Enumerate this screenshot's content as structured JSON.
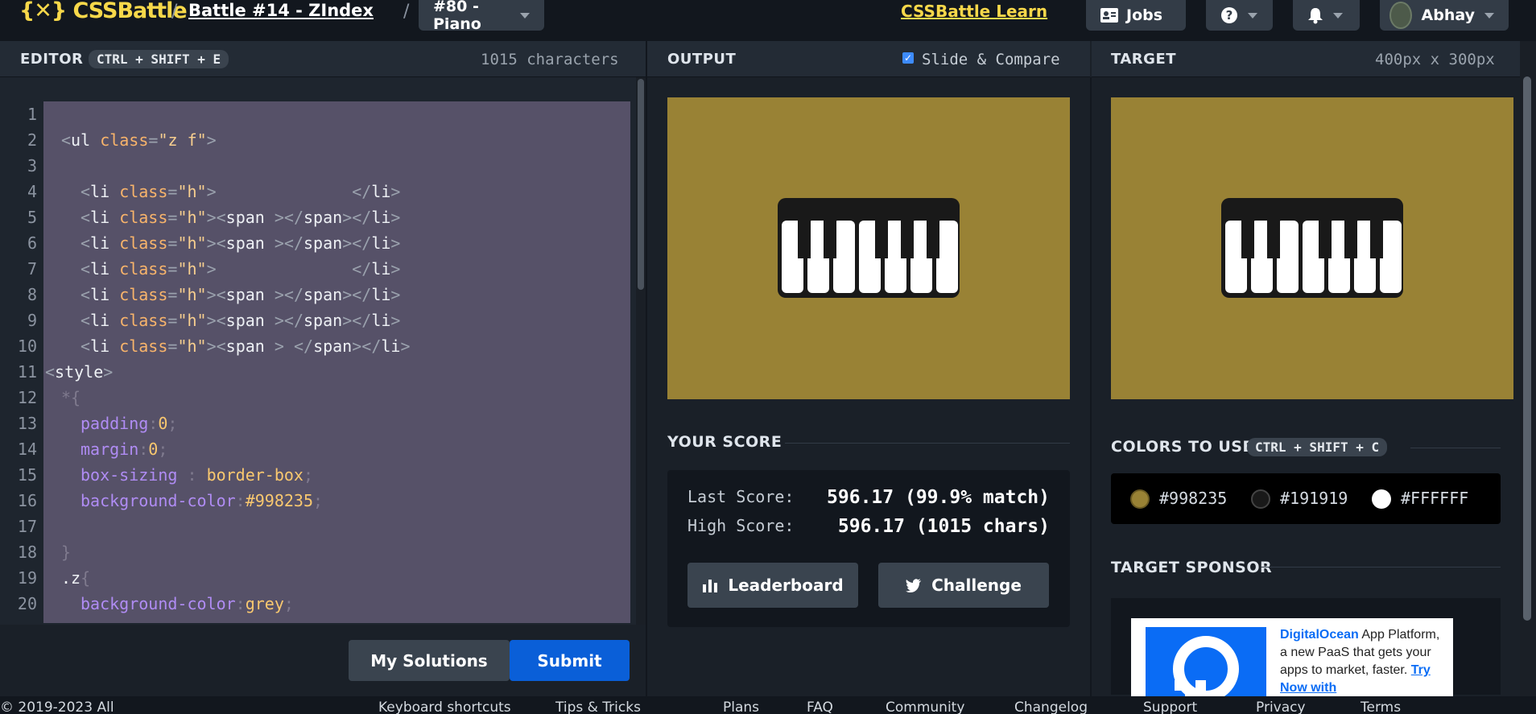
{
  "header": {
    "logo": "{𝌗} CSSBattle",
    "logo_text": "{✕} CSSBattle",
    "battle": "Battle #14 - ZIndex",
    "target_select": "#80 - Piano",
    "learn_link": "CSSBattle Learn",
    "jobs": "Jobs",
    "user": "Abhay"
  },
  "editor": {
    "title": "EDITOR",
    "shortcut": "CTRL + SHIFT + E",
    "char_count": "1015 characters",
    "my_solutions": "My Solutions",
    "submit": "Submit"
  },
  "output": {
    "title": "OUTPUT",
    "slide_compare": "Slide & Compare",
    "slide_checked": true
  },
  "target": {
    "title": "TARGET",
    "size": "400px x 300px"
  },
  "score": {
    "title": "YOUR SCORE",
    "last_label": "Last Score:",
    "last_value": "596.17 (99.9% match)",
    "high_label": "High Score:",
    "high_value": "596.17 (1015 chars)",
    "leaderboard": "Leaderboard",
    "challenge": "Challenge"
  },
  "colors": {
    "title": "COLORS TO USE",
    "shortcut": "CTRL + SHIFT + C",
    "list": [
      {
        "hex": "#998235"
      },
      {
        "hex": "#191919"
      },
      {
        "hex": "#FFFFFF"
      }
    ]
  },
  "sponsor": {
    "title": "TARGET SPONSOR",
    "brand": "DigitalOcean",
    "text": " App Platform, a new PaaS that gets your apps to market, faster.",
    "cta": "Try Now with"
  },
  "footer": {
    "copyright": "© 2019-2023 All",
    "items": [
      "Keyboard shortcuts",
      "Tips & Tricks",
      "Plans",
      "FAQ",
      "Community",
      "Changelog",
      "Support",
      "Privacy",
      "Terms"
    ]
  },
  "code_lines": [
    {
      "n": "1"
    },
    {
      "n": "2"
    },
    {
      "n": "3"
    },
    {
      "n": "4"
    },
    {
      "n": "5"
    },
    {
      "n": "6"
    },
    {
      "n": "7"
    },
    {
      "n": "8"
    },
    {
      "n": "9"
    },
    {
      "n": "10"
    },
    {
      "n": "11"
    },
    {
      "n": "12"
    },
    {
      "n": "13"
    },
    {
      "n": "14"
    },
    {
      "n": "15"
    },
    {
      "n": "16"
    },
    {
      "n": "17"
    },
    {
      "n": "18"
    },
    {
      "n": "19"
    },
    {
      "n": "20"
    }
  ],
  "code": {
    "l2_tag": "ul",
    "l2_attr": "class",
    "l2_val": "\"z f\"",
    "li": "li",
    "class": "class",
    "h": "\"h\"",
    "span": "span",
    "style": "style",
    "star": "*{",
    "p1": "padding",
    "v1": "0",
    "p2": "margin",
    "v2": "0",
    "p3": "box-sizing",
    "v3": "border-box",
    "p4": "background-color",
    "v4": "#998235",
    "close": "}",
    "sel_z": ".z",
    "p5": "background-color",
    "v5": "grey"
  }
}
